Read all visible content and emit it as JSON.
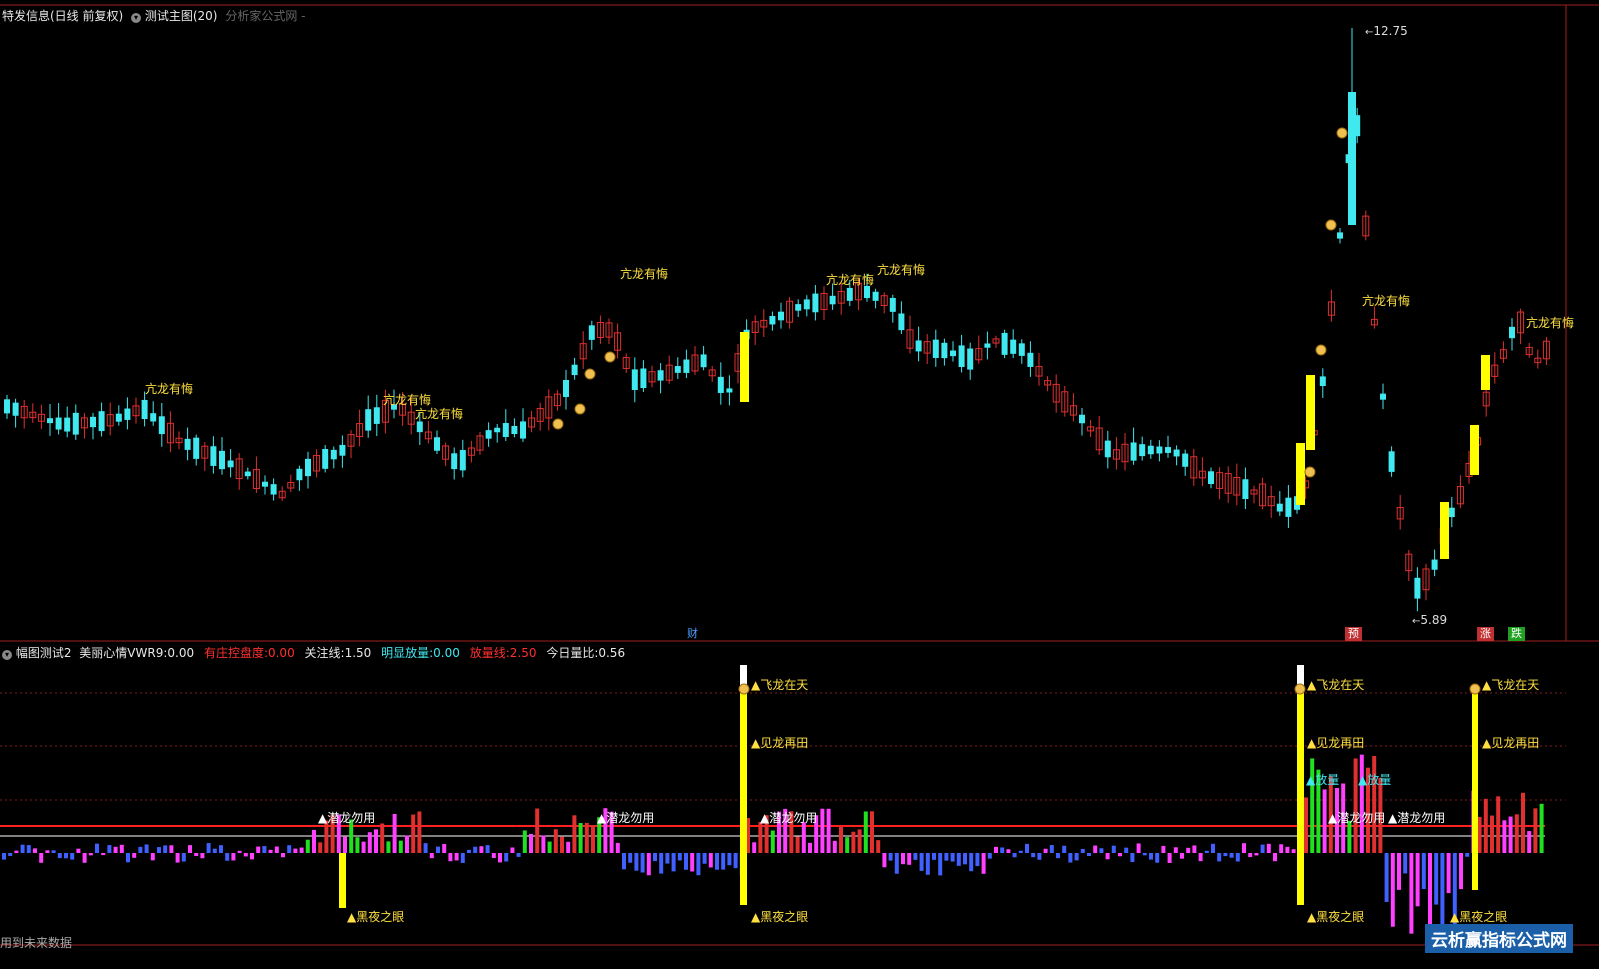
{
  "colors": {
    "background": "#000000",
    "up": "#e03030",
    "down": "#40e8f0",
    "yellow": "#ffff00",
    "label_yellow": "#ffe040",
    "red_line": "#ff2020",
    "white_line": "#ffffff",
    "magenta": "#ff40ff",
    "blue": "#4060ff",
    "green": "#20e020"
  },
  "main_header": {
    "title": "特发信息(日线 前复权)",
    "indicator": "测试主图(20)",
    "source": "分析家公式网 -"
  },
  "main_chart": {
    "high_label": "12.75",
    "low_label": "5.89",
    "signal_label": "亢龙有悔",
    "markers": {
      "cai": "财",
      "yu": "预",
      "zhang": "涨",
      "die": "跌"
    }
  },
  "sub_header": {
    "name": "幅图测试2",
    "items": [
      {
        "label": "美丽心情VWR9:",
        "value": "0.00"
      },
      {
        "label": "有庄控盘度:",
        "value": "0.00"
      },
      {
        "label": "关注线:",
        "value": "1.50"
      },
      {
        "label": "明显放量:",
        "value": "0.00"
      },
      {
        "label": "放量线:",
        "value": "2.50"
      },
      {
        "label": "今日量比:",
        "value": "0.56"
      }
    ]
  },
  "sub_labels": {
    "fly": "飞龙在天",
    "see": "见龙再田",
    "hidden": "潜龙勿用",
    "night": "黑夜之眼",
    "volume": "放量"
  },
  "footer": {
    "left_text": "用到未来数据",
    "watermark": "云析赢指标公式网"
  }
}
